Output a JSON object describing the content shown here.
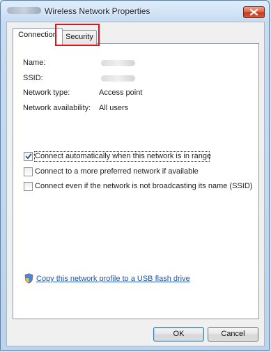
{
  "window": {
    "title": "Wireless Network Properties",
    "close_label": "✕"
  },
  "tabs": [
    {
      "label": "Connection",
      "selected": true
    },
    {
      "label": "Security",
      "selected": false,
      "highlighted": true
    }
  ],
  "connection": {
    "fields": [
      {
        "label": "Name:",
        "value": ""
      },
      {
        "label": "SSID:",
        "value": ""
      },
      {
        "label": "Network type:",
        "value": "Access point"
      },
      {
        "label": "Network availability:",
        "value": "All users"
      }
    ],
    "options": [
      {
        "label": "Connect automatically when this network is in range",
        "checked": true
      },
      {
        "label": "Connect to a more preferred network if available",
        "checked": false
      },
      {
        "label": "Connect even if the network is not broadcasting its name (SSID)",
        "checked": false
      }
    ],
    "usb_link": "Copy this network profile to a USB flash drive"
  },
  "buttons": {
    "ok": "OK",
    "cancel": "Cancel"
  },
  "colors": {
    "link": "#1b53b8",
    "highlight": "#e0141a"
  },
  "icons": {
    "close": "close-icon",
    "checkmark": "checkmark-icon",
    "shield": "shield-icon"
  }
}
